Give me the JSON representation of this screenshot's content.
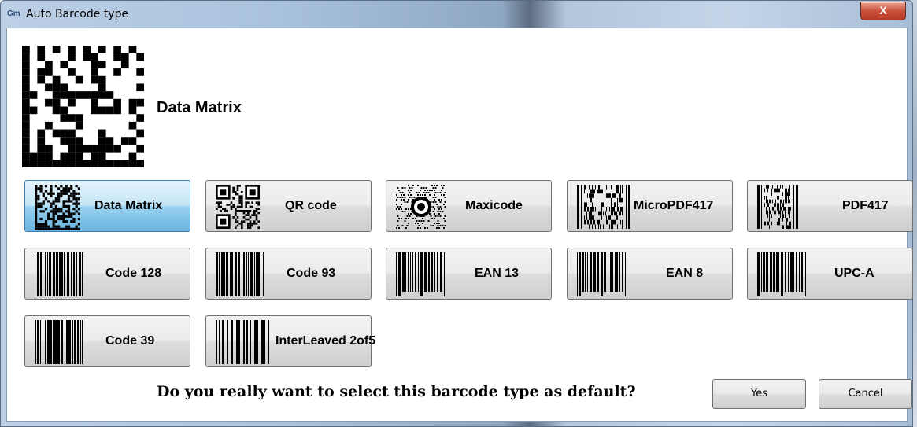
{
  "window": {
    "title": "Auto Barcode type",
    "icon_text": "Gm",
    "close_glyph": "X"
  },
  "preview": {
    "label": "Data Matrix",
    "icon": "datamatrix-icon"
  },
  "barcode_buttons": [
    {
      "label": "Data Matrix",
      "icon": "datamatrix-icon",
      "selected": true
    },
    {
      "label": "QR code",
      "icon": "qrcode-icon",
      "selected": false
    },
    {
      "label": "Maxicode",
      "icon": "maxicode-icon",
      "selected": false
    },
    {
      "label": "MicroPDF417",
      "icon": "micropdf417-icon",
      "selected": false
    },
    {
      "label": "PDF417",
      "icon": "pdf417-icon",
      "selected": false
    },
    {
      "label": "Code 128",
      "icon": "code128-icon",
      "selected": false
    },
    {
      "label": "Code 93",
      "icon": "code93-icon",
      "selected": false
    },
    {
      "label": "EAN 13",
      "icon": "ean13-icon",
      "selected": false
    },
    {
      "label": "EAN 8",
      "icon": "ean8-icon",
      "selected": false
    },
    {
      "label": "UPC-A",
      "icon": "upca-icon",
      "selected": false
    },
    {
      "label": "Code 39",
      "icon": "code39-icon",
      "selected": false
    },
    {
      "label": "InterLeaved 2of5",
      "icon": "interleaved2of5-icon",
      "selected": false
    }
  ],
  "prompt": {
    "question": "Do you really want to select this barcode type as default?",
    "yes_label": "Yes",
    "cancel_label": "Cancel"
  },
  "colors": {
    "selected_button": "#98d1ef",
    "close_button": "#c9503a"
  }
}
